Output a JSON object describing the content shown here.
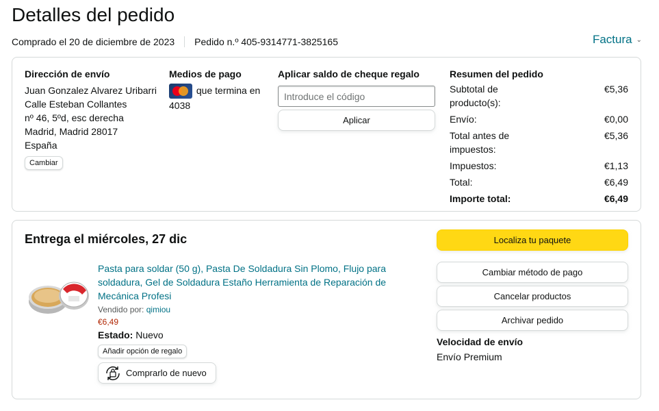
{
  "header": {
    "title": "Detalles del pedido",
    "purchased": "Comprado el 20 de diciembre de 2023",
    "order_number": "Pedido n.º 405-9314771-3825165",
    "invoice_label": "Factura"
  },
  "shipping": {
    "title": "Dirección de envío",
    "lines": [
      "Juan Gonzalez Alvarez Uribarri",
      "Calle Esteban Collantes",
      "nº 46, 5ºd, esc derecha",
      "Madrid, Madrid 28017",
      "España"
    ],
    "change_label": "Cambiar"
  },
  "payment": {
    "title": "Medios de pago",
    "ending_text": "que termina en",
    "last_digits": "4038",
    "card_icon": "mastercard-icon"
  },
  "gift_card": {
    "title": "Aplicar saldo de cheque regalo",
    "placeholder": "Introduce el código",
    "value": "",
    "apply_label": "Aplicar"
  },
  "summary": {
    "title": "Resumen del pedido",
    "rows": [
      {
        "label": "Subtotal de producto(s):",
        "value": "€5,36"
      },
      {
        "label": "Envío:",
        "value": "€0,00"
      },
      {
        "label": "Total antes de impuestos:",
        "value": "€5,36"
      },
      {
        "label": "Impuestos:",
        "value": "€1,13"
      },
      {
        "label": "Total:",
        "value": "€6,49"
      }
    ],
    "grand_total_label": "Importe total:",
    "grand_total_value": "€6,49"
  },
  "delivery": {
    "title": "Entrega el miércoles, 27 dic",
    "product": {
      "title": "Pasta para soldar (50 g), Pasta De Soldadura Sin Plomo, Flujo para soldadura, Gel de Soldadura Estaño Herramienta de Reparación de Mecánica Profesi",
      "sold_by_label": "Vendido por:",
      "seller": "qimiou",
      "price": "€6,49",
      "state_label": "Estado:",
      "state_value": "Nuevo",
      "gift_option_label": "Añadir opción de regalo",
      "buy_again_label": "Comprarlo de nuevo"
    },
    "actions": {
      "track": "Localiza tu paquete",
      "change_payment": "Cambiar método de pago",
      "cancel": "Cancelar productos",
      "archive": "Archivar pedido"
    },
    "shipping_speed_title": "Velocidad de envío",
    "shipping_speed_value": "Envío Premium"
  },
  "colors": {
    "link": "#007185",
    "price": "#b12704",
    "primary_button": "#ffd814",
    "border": "#d5d9d9"
  }
}
